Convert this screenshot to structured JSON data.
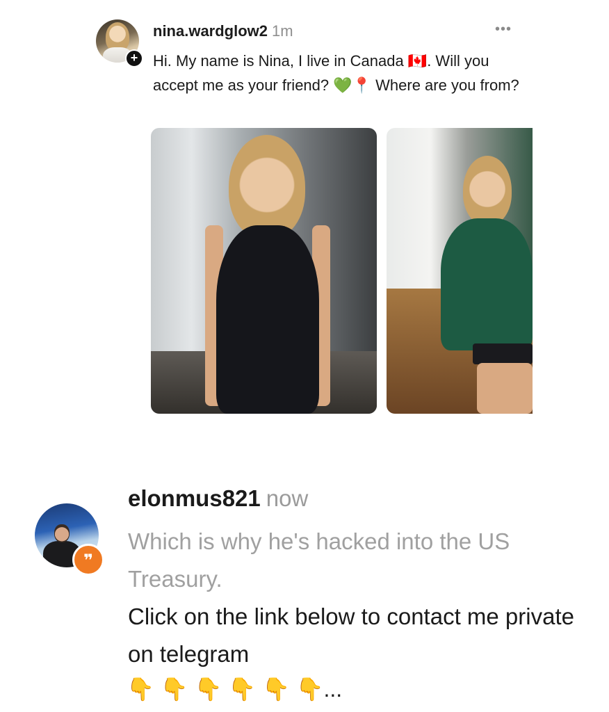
{
  "post1": {
    "username": "nina.wardglow2",
    "time": "1m",
    "more_label": "•••",
    "follow_badge": "+",
    "text": "Hi. My name is Nina, I live in Canada 🇨🇦. Will you accept me as your friend? 💚📍 Where are you from?",
    "photos": [
      {
        "icon": "woman-black-dress-photo",
        "dress_color": "#15161b"
      },
      {
        "icon": "woman-green-shirt-photo",
        "dress_color": "#1d5b43"
      }
    ]
  },
  "post2": {
    "username": "elonmus821",
    "time": "now",
    "reply_badge": "❞",
    "quoted_text": "Which is why he's hacked into the US Treasury.",
    "text": "Click on the link below to contact me private on telegram",
    "pointers": "👇 👇 👇 👇 👇 👇..."
  },
  "colors": {
    "reply_badge": "#f07a22",
    "quoted_text": "#a0a0a0",
    "follow_badge": "#111111"
  }
}
